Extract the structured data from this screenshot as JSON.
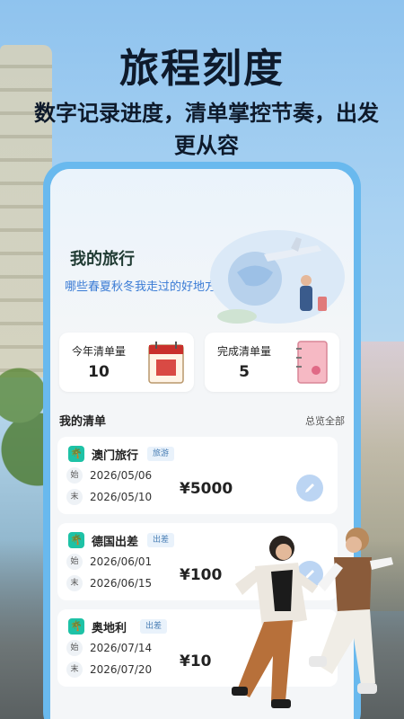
{
  "hero": {
    "title": "旅程刻度",
    "subtitle": "数字记录进度，清单掌控节奏，出发更从容"
  },
  "app": {
    "section_title": "我的旅行",
    "section_subtitle": "哪些春夏秋冬我走过的好地方",
    "stats": [
      {
        "label": "今年清单量",
        "value": "10",
        "icon": "calendar-icon"
      },
      {
        "label": "完成清单量",
        "value": "5",
        "icon": "notebook-icon"
      }
    ],
    "list_header": {
      "title": "我的清单",
      "link": "总览全部"
    },
    "lists": [
      {
        "name": "澳门旅行",
        "tag": "旅游",
        "start_label": "始",
        "start": "2026/05/06",
        "end_label": "末",
        "end": "2026/05/10",
        "price": "¥5000"
      },
      {
        "name": "德国出差",
        "tag": "出差",
        "start_label": "始",
        "start": "2026/06/01",
        "end_label": "末",
        "end": "2026/06/15",
        "price": "¥100"
      },
      {
        "name": "奥地利",
        "tag": "出差",
        "start_label": "始",
        "start": "2026/07/14",
        "end_label": "末",
        "end": "2026/07/20",
        "price": "¥10"
      }
    ]
  },
  "colors": {
    "accent": "#69b9ee",
    "icon_bg": "#1ec2a6",
    "link": "#3a7bd5"
  }
}
